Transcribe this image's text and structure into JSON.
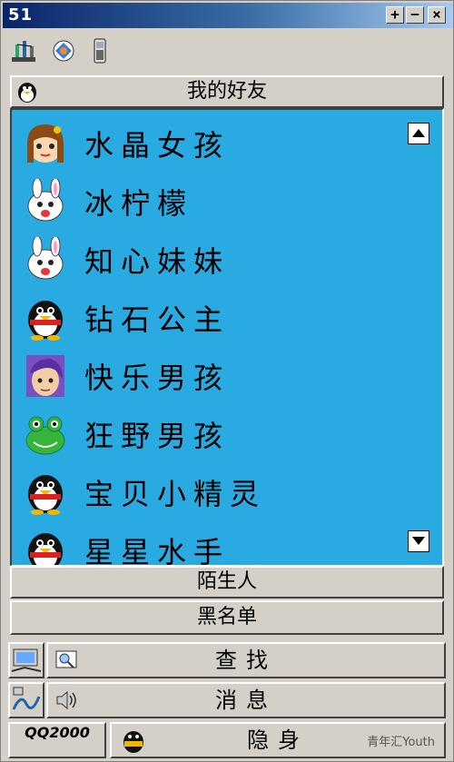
{
  "window": {
    "title": "51",
    "btn_plus": "+",
    "btn_minus": "−",
    "btn_close": "×"
  },
  "group_header": {
    "label": "我的好友"
  },
  "friends": [
    {
      "name": "水晶女孩",
      "avatar": "girl-avatar-icon"
    },
    {
      "name": "冰柠檬",
      "avatar": "white-rabbit-icon"
    },
    {
      "name": "知心妹妹",
      "avatar": "white-rabbit-icon"
    },
    {
      "name": "钻石公主",
      "avatar": "penguin-icon"
    },
    {
      "name": "快乐男孩",
      "avatar": "boy-avatar-icon"
    },
    {
      "name": "狂野男孩",
      "avatar": "frog-icon"
    },
    {
      "name": "宝贝小精灵",
      "avatar": "penguin-icon"
    },
    {
      "name": "星星水手",
      "avatar": "penguin-icon"
    }
  ],
  "groups": {
    "strangers": "陌生人",
    "blacklist": "黑名单"
  },
  "actions": {
    "search": "查找",
    "messages": "消息",
    "invisible": "隐身"
  },
  "logo_text": "QQ2000",
  "watermark": "青年汇Youth",
  "colors": {
    "list_bg": "#29abe2",
    "title_start": "#0a246a",
    "title_end": "#a6caf0",
    "panel": "#d4d0c8"
  }
}
